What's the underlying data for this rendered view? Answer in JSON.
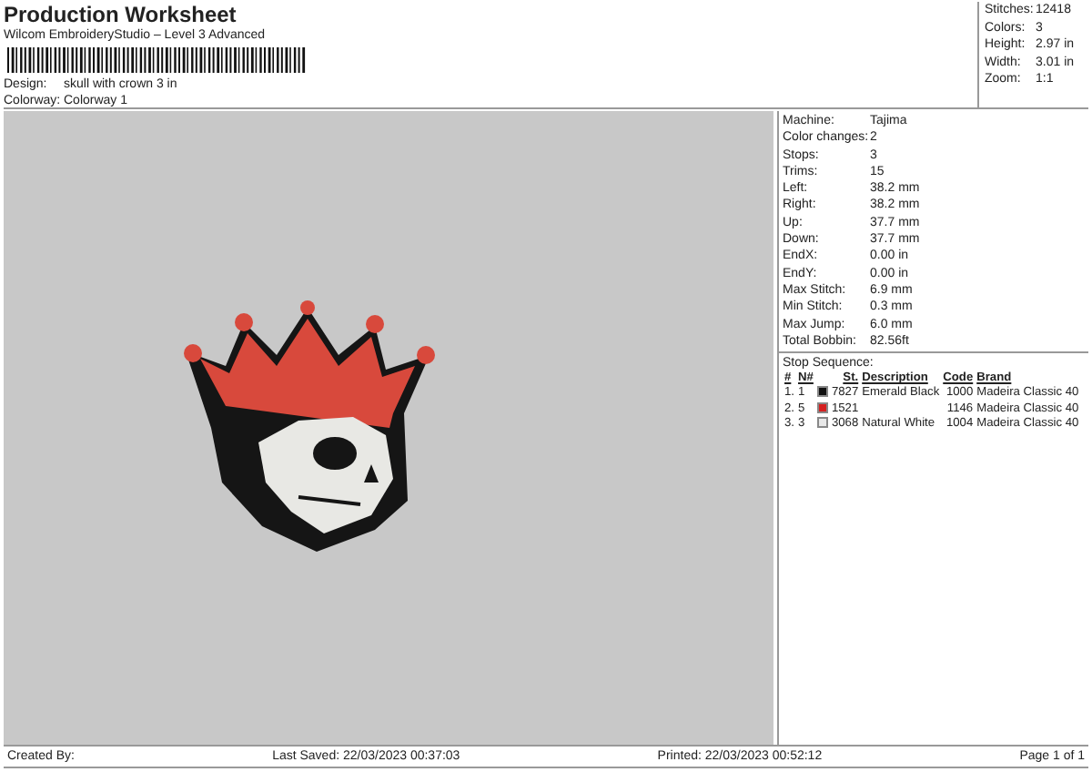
{
  "header": {
    "title": "Production Worksheet",
    "subtitle": "Wilcom EmbroideryStudio – Level 3 Advanced",
    "fields": [
      {
        "label": "Design:",
        "value": "skull with crown 3 in"
      },
      {
        "label": "Colorway:",
        "value": "Colorway 1"
      }
    ]
  },
  "summary": [
    {
      "label": "Stitches:",
      "value": "12418"
    },
    {
      "label": "Colors:",
      "value": "3"
    },
    {
      "label": "Height:",
      "value": "2.97 in"
    },
    {
      "label": "Width:",
      "value": "3.01 in"
    },
    {
      "label": "Zoom:",
      "value": "1:1"
    }
  ],
  "details": [
    {
      "label": "Machine:",
      "value": "Tajima"
    },
    {
      "label": "Color changes:",
      "value": "2"
    },
    {
      "label": "Stops:",
      "value": "3"
    },
    {
      "label": "Trims:",
      "value": "15"
    },
    {
      "label": "Left:",
      "value": "38.2 mm"
    },
    {
      "label": "Right:",
      "value": "38.2 mm"
    },
    {
      "label": "Up:",
      "value": "37.7 mm"
    },
    {
      "label": "Down:",
      "value": "37.7 mm"
    },
    {
      "label": "EndX:",
      "value": "0.00 in"
    },
    {
      "label": "EndY:",
      "value": "0.00 in"
    },
    {
      "label": "Max Stitch:",
      "value": "6.9 mm"
    },
    {
      "label": "Min Stitch:",
      "value": "0.3 mm"
    },
    {
      "label": "Max Jump:",
      "value": "6.0 mm"
    },
    {
      "label": "Total Bobbin:",
      "value": "82.56ft"
    }
  ],
  "stop_sequence": {
    "title": "Stop Sequence:",
    "columns": [
      "#",
      "N#",
      "St.",
      "Description",
      "Code",
      "Brand"
    ],
    "rows": [
      {
        "index": "1.",
        "needle": "1",
        "color": "#111111",
        "stitches": "7827",
        "description": "Emerald Black",
        "code": "1000",
        "brand": "Madeira Classic 40"
      },
      {
        "index": "2.",
        "needle": "5",
        "color": "#d42020",
        "stitches": "1521",
        "description": "",
        "code": "1146",
        "brand": "Madeira Classic 40"
      },
      {
        "index": "3.",
        "needle": "3",
        "color": "#e8e8e8",
        "stitches": "3068",
        "description": "Natural White",
        "code": "1004",
        "brand": "Madeira Classic 40"
      }
    ]
  },
  "footer": {
    "created_by": "Created By:",
    "last_saved": "Last Saved: 22/03/2023 00:37:03",
    "printed": "Printed: 22/03/2023 00:52:12",
    "page": "Page 1 of 1"
  }
}
